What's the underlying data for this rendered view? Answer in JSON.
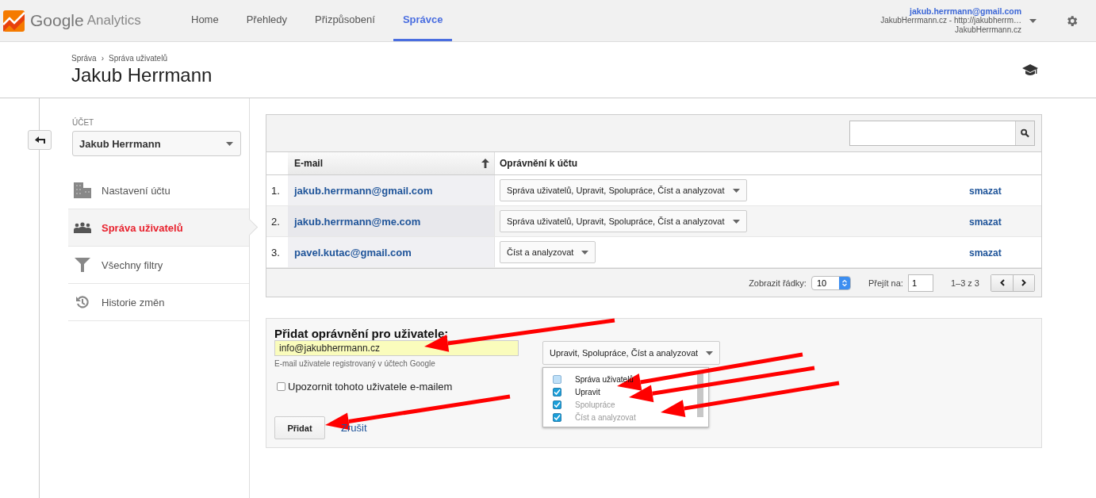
{
  "header": {
    "logo_word": "Google",
    "logo_product": "Analytics",
    "nav": [
      {
        "label": "Home",
        "selected": false
      },
      {
        "label": "Přehledy",
        "selected": false
      },
      {
        "label": "Přizpůsobení",
        "selected": false
      },
      {
        "label": "Správce",
        "selected": true
      }
    ],
    "account": {
      "email": "jakub.herrmann@gmail.com",
      "property": "JakubHerrmann.cz - http://jakubherrm…",
      "view": "JakubHerrmann.cz"
    }
  },
  "breadcrumb": {
    "items": [
      "Správa",
      "Správa uživatelů"
    ],
    "separator": "›"
  },
  "page_title": "Jakub Herrmann",
  "sidebar": {
    "section_label": "ÚČET",
    "account_select": "Jakub Herrmann",
    "items": [
      {
        "label": "Nastavení účtu",
        "selected": false
      },
      {
        "label": "Správa uživatelů",
        "selected": true
      },
      {
        "label": "Všechny filtry",
        "selected": false
      },
      {
        "label": "Historie změn",
        "selected": false
      }
    ]
  },
  "users_table": {
    "columns": [
      "E-mail",
      "Oprávnění k účtu"
    ],
    "rows": [
      {
        "number": "1.",
        "email": "jakub.herrmann@gmail.com",
        "permissions": "Správa uživatelů, Upravit, Spolupráce, Číst a analyzovat",
        "action": "smazat"
      },
      {
        "number": "2.",
        "email": "jakub.herrmann@me.com",
        "permissions": "Správa uživatelů, Upravit, Spolupráce, Číst a analyzovat",
        "action": "smazat"
      },
      {
        "number": "3.",
        "email": "pavel.kutac@gmail.com",
        "permissions": "Číst a analyzovat",
        "action": "smazat"
      }
    ],
    "footer": {
      "rows_label": "Zobrazit řádky:",
      "rows_value": "10",
      "goto_label": "Přejít na:",
      "goto_value": "1",
      "range": "1–3 z 3"
    }
  },
  "add_form": {
    "title": "Přidat oprávnění pro uživatele:",
    "email_value": "info@jakubherrmann.cz",
    "hint": "E-mail uživatele registrovaný v účtech Google",
    "notify": {
      "label": "Upozornit tohoto uživatele e-mailem",
      "checked": false
    },
    "permission_select": "Upravit, Spolupráce, Číst a analyzovat",
    "options": [
      {
        "label": "Správa uživatelů",
        "checked": false,
        "disabled": false
      },
      {
        "label": "Upravit",
        "checked": true,
        "disabled": false
      },
      {
        "label": "Spolupráce",
        "checked": true,
        "disabled": true
      },
      {
        "label": "Číst a analyzovat",
        "checked": true,
        "disabled": true
      }
    ],
    "submit": "Přidat",
    "cancel": "Zrušit"
  }
}
